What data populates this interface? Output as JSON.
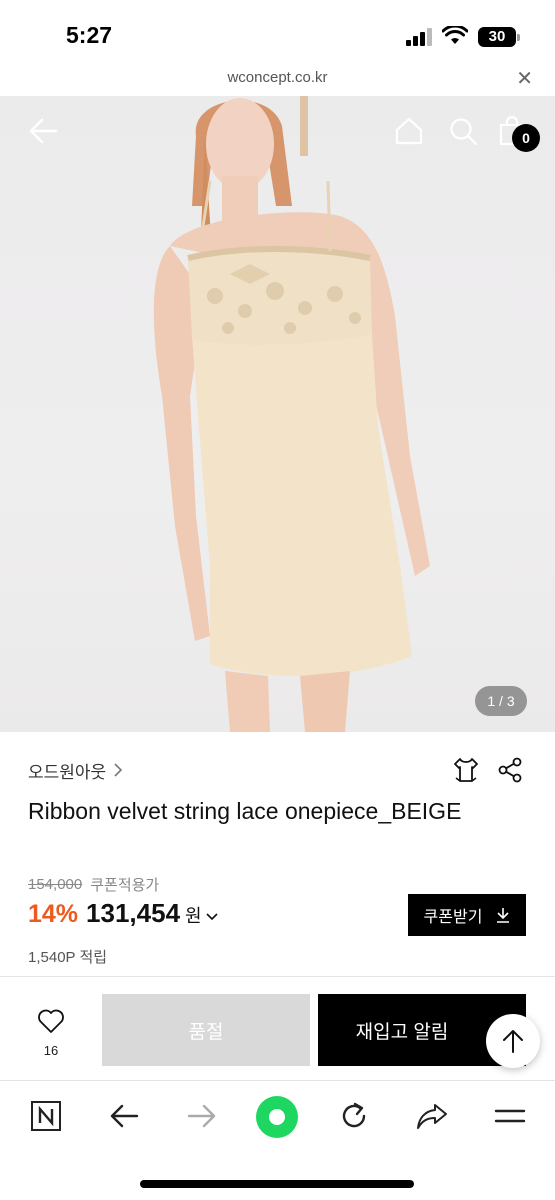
{
  "status_bar": {
    "time": "5:27",
    "battery": "30"
  },
  "url_bar": {
    "url": "wconcept.co.kr"
  },
  "hero": {
    "page_indicator": "1 / 3",
    "cart_count": "0"
  },
  "product": {
    "brand": "오드원아웃",
    "title": "Ribbon velvet string lace onepiece_BEIGE",
    "original_price": "154,000",
    "coupon_note": "쿠폰적용가",
    "discount": "14%",
    "price": "131,454",
    "currency": "원",
    "coupon_button": "쿠폰받기",
    "points": "1,540P 적립"
  },
  "actions": {
    "like_count": "16",
    "sold_out": "품절",
    "restock_alert": "재입고 알림"
  },
  "colors": {
    "accent_discount": "#ec5a1e",
    "primary_button": "#000000",
    "disabled_button": "#d9d9d9",
    "browser_green": "#1ed760"
  },
  "icons": {
    "header": [
      "back-arrow-icon",
      "home-icon",
      "search-icon",
      "shopping-bag-icon"
    ],
    "product": [
      "hanger-icon",
      "share-icon",
      "chevron-right-icon",
      "chevron-down-icon",
      "download-icon"
    ],
    "actions": [
      "heart-icon",
      "arrow-up-icon"
    ],
    "toolbar": [
      "naver-n-icon",
      "back-icon",
      "forward-icon",
      "green-dot-icon",
      "reload-icon",
      "share-arrow-icon",
      "menu-icon"
    ]
  }
}
